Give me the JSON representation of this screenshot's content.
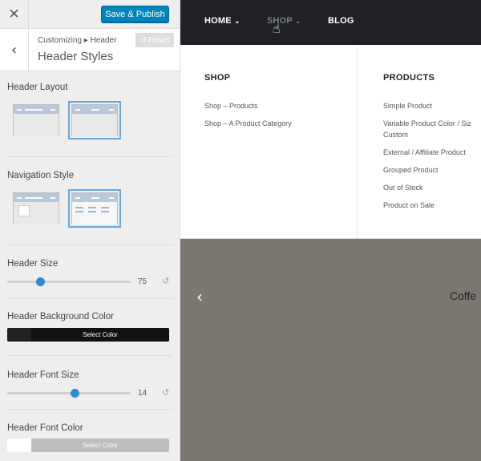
{
  "customizer": {
    "close_icon": "close-icon",
    "close_glyph": "✕",
    "publish_label": "Save & Publish",
    "back_glyph": "‹",
    "breadcrumb": "Customizing ▸ Header",
    "section_title": "Header Styles",
    "reset_label": "Reset",
    "reset_glyph": "↺",
    "controls": {
      "header_layout": {
        "label": "Header Layout",
        "selected_option": 2
      },
      "navigation_style": {
        "label": "Navigation Style",
        "selected_option": 2
      },
      "header_size": {
        "label": "Header Size",
        "value": "75",
        "fraction": 0.27
      },
      "header_bg_color": {
        "label": "Header Background Color",
        "button_label": "Select Color",
        "color": "#1f2125"
      },
      "header_font_size": {
        "label": "Header Font Size",
        "value": "14",
        "fraction": 0.55
      },
      "header_font_color": {
        "label": "Header Font Color",
        "button_label": "Select Color",
        "color": "#ffffff"
      }
    },
    "accent_color": "#0085ba"
  },
  "preview": {
    "nav": [
      {
        "label": "HOME",
        "has_dropdown": true
      },
      {
        "label": "SHOP",
        "has_dropdown": true,
        "hovered": true
      },
      {
        "label": "BLOG",
        "has_dropdown": false
      }
    ],
    "chevron_glyph": "⌄",
    "cursor_icon": "hand-cursor-icon",
    "cursor_glyph": "☝",
    "mega_menu": {
      "shop": {
        "heading": "SHOP",
        "links": [
          "Shop – Products",
          "Shop – A Product Category"
        ]
      },
      "products": {
        "heading": "PRODUCTS",
        "links": [
          "Simple Product",
          "Variable Product Color / Siz",
          "Custom",
          "External / Affiliate Product",
          "Grouped Product",
          "Out of Stock",
          "Product on Sale"
        ]
      }
    },
    "slider": {
      "prev_glyph": "‹",
      "text": "Coffe"
    }
  }
}
